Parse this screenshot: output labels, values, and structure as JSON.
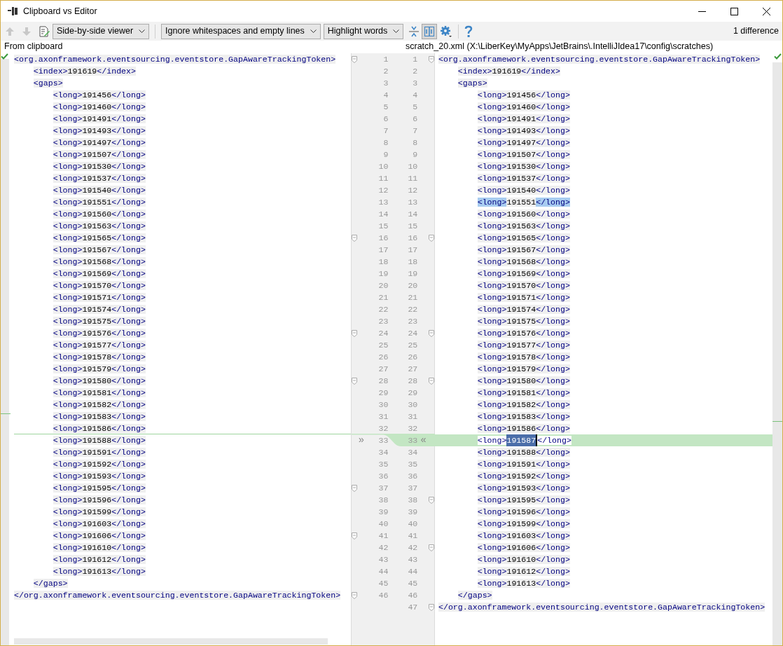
{
  "window": {
    "title": "Clipboard vs Editor"
  },
  "toolbar": {
    "viewer": "Side-by-side viewer",
    "whitespace": "Ignore whitespaces and empty lines",
    "highlighting": "Highlight words",
    "side_by_side_selected": true,
    "difference_count": "1 difference"
  },
  "gutter": {
    "apply_left": "»",
    "apply_right": "«"
  },
  "left_panel": {
    "header": "From clipboard",
    "lines": [
      {
        "number": "1",
        "text": "<org.axonframework.eventsourcing.eventstore.GapAwareTrackingToken>",
        "fold": true,
        "insertion_below": false
      },
      {
        "number": "2",
        "text": "    <index>191619</index>",
        "fold": false,
        "insertion_below": false
      },
      {
        "number": "3",
        "text": "    <gaps>",
        "fold": false,
        "insertion_below": false
      },
      {
        "number": "4",
        "text": "        <long>191456</long>",
        "fold": false,
        "insertion_below": false
      },
      {
        "number": "5",
        "text": "        <long>191460</long>",
        "fold": false,
        "insertion_below": false
      },
      {
        "number": "6",
        "text": "        <long>191491</long>",
        "fold": false,
        "insertion_below": false
      },
      {
        "number": "7",
        "text": "        <long>191493</long>",
        "fold": false,
        "insertion_below": false
      },
      {
        "number": "8",
        "text": "        <long>191497</long>",
        "fold": false,
        "insertion_below": false
      },
      {
        "number": "9",
        "text": "        <long>191507</long>",
        "fold": false,
        "insertion_below": false
      },
      {
        "number": "10",
        "text": "        <long>191530</long>",
        "fold": false,
        "insertion_below": false
      },
      {
        "number": "11",
        "text": "        <long>191537</long>",
        "fold": false,
        "insertion_below": false
      },
      {
        "number": "12",
        "text": "        <long>191540</long>",
        "fold": false,
        "insertion_below": false
      },
      {
        "number": "13",
        "text": "        <long>191551</long>",
        "fold": false,
        "insertion_below": false
      },
      {
        "number": "14",
        "text": "        <long>191560</long>",
        "fold": false,
        "insertion_below": false
      },
      {
        "number": "15",
        "text": "        <long>191563</long>",
        "fold": false,
        "insertion_below": false
      },
      {
        "number": "16",
        "text": "        <long>191565</long>",
        "fold": true,
        "insertion_below": false
      },
      {
        "number": "17",
        "text": "        <long>191567</long>",
        "fold": false,
        "insertion_below": false
      },
      {
        "number": "18",
        "text": "        <long>191568</long>",
        "fold": false,
        "insertion_below": false
      },
      {
        "number": "19",
        "text": "        <long>191569</long>",
        "fold": false,
        "insertion_below": false
      },
      {
        "number": "20",
        "text": "        <long>191570</long>",
        "fold": false,
        "insertion_below": false
      },
      {
        "number": "21",
        "text": "        <long>191571</long>",
        "fold": false,
        "insertion_below": false
      },
      {
        "number": "22",
        "text": "        <long>191574</long>",
        "fold": false,
        "insertion_below": false
      },
      {
        "number": "23",
        "text": "        <long>191575</long>",
        "fold": false,
        "insertion_below": false
      },
      {
        "number": "24",
        "text": "        <long>191576</long>",
        "fold": true,
        "insertion_below": false
      },
      {
        "number": "25",
        "text": "        <long>191577</long>",
        "fold": false,
        "insertion_below": false
      },
      {
        "number": "26",
        "text": "        <long>191578</long>",
        "fold": false,
        "insertion_below": false
      },
      {
        "number": "27",
        "text": "        <long>191579</long>",
        "fold": false,
        "insertion_below": false
      },
      {
        "number": "28",
        "text": "        <long>191580</long>",
        "fold": true,
        "insertion_below": false
      },
      {
        "number": "29",
        "text": "        <long>191581</long>",
        "fold": false,
        "insertion_below": false
      },
      {
        "number": "30",
        "text": "        <long>191582</long>",
        "fold": false,
        "insertion_below": false
      },
      {
        "number": "31",
        "text": "        <long>191583</long>",
        "fold": false,
        "insertion_below": false
      },
      {
        "number": "32",
        "text": "        <long>191586</long>",
        "fold": false,
        "insertion_below": true
      },
      {
        "number": "33",
        "text": "        <long>191588</long>",
        "fold": false,
        "insertion_below": false
      },
      {
        "number": "34",
        "text": "        <long>191591</long>",
        "fold": false,
        "insertion_below": false
      },
      {
        "number": "35",
        "text": "        <long>191592</long>",
        "fold": false,
        "insertion_below": false
      },
      {
        "number": "36",
        "text": "        <long>191593</long>",
        "fold": false,
        "insertion_below": false
      },
      {
        "number": "37",
        "text": "        <long>191595</long>",
        "fold": true,
        "insertion_below": false
      },
      {
        "number": "38",
        "text": "        <long>191596</long>",
        "fold": false,
        "insertion_below": false
      },
      {
        "number": "39",
        "text": "        <long>191599</long>",
        "fold": false,
        "insertion_below": false
      },
      {
        "number": "40",
        "text": "        <long>191603</long>",
        "fold": false,
        "insertion_below": false
      },
      {
        "number": "41",
        "text": "        <long>191606</long>",
        "fold": true,
        "insertion_below": false
      },
      {
        "number": "42",
        "text": "        <long>191610</long>",
        "fold": false,
        "insertion_below": false
      },
      {
        "number": "43",
        "text": "        <long>191612</long>",
        "fold": false,
        "insertion_below": false
      },
      {
        "number": "44",
        "text": "        <long>191613</long>",
        "fold": false,
        "insertion_below": false
      },
      {
        "number": "45",
        "text": "    </gaps>",
        "fold": false,
        "insertion_below": false
      },
      {
        "number": "46",
        "text": "</org.axonframework.eventsourcing.eventstore.GapAwareTrackingToken>",
        "fold": true,
        "insertion_below": false
      }
    ]
  },
  "right_panel": {
    "header": "scratch_20.xml (X:\\LiberKey\\MyApps\\JetBrains\\.IntelliJIdea17\\config\\scratches)",
    "lines": [
      {
        "number": "1",
        "text": "<org.axonframework.eventsourcing.eventstore.GapAwareTrackingToken>",
        "fold": true,
        "inserted": false,
        "tag_match": false
      },
      {
        "number": "2",
        "text": "    <index>191619</index>",
        "fold": false,
        "inserted": false,
        "tag_match": false
      },
      {
        "number": "3",
        "text": "    <gaps>",
        "fold": false,
        "inserted": false,
        "tag_match": false
      },
      {
        "number": "4",
        "text": "        <long>191456</long>",
        "fold": false,
        "inserted": false,
        "tag_match": false
      },
      {
        "number": "5",
        "text": "        <long>191460</long>",
        "fold": false,
        "inserted": false,
        "tag_match": false
      },
      {
        "number": "6",
        "text": "        <long>191491</long>",
        "fold": false,
        "inserted": false,
        "tag_match": false
      },
      {
        "number": "7",
        "text": "        <long>191493</long>",
        "fold": false,
        "inserted": false,
        "tag_match": false
      },
      {
        "number": "8",
        "text": "        <long>191497</long>",
        "fold": false,
        "inserted": false,
        "tag_match": false
      },
      {
        "number": "9",
        "text": "        <long>191507</long>",
        "fold": false,
        "inserted": false,
        "tag_match": false
      },
      {
        "number": "10",
        "text": "        <long>191530</long>",
        "fold": false,
        "inserted": false,
        "tag_match": false
      },
      {
        "number": "11",
        "text": "        <long>191537</long>",
        "fold": false,
        "inserted": false,
        "tag_match": false
      },
      {
        "number": "12",
        "text": "        <long>191540</long>",
        "fold": false,
        "inserted": false,
        "tag_match": false
      },
      {
        "number": "13",
        "text": "        <long>191551</long>",
        "fold": false,
        "inserted": false,
        "tag_match": true
      },
      {
        "number": "14",
        "text": "        <long>191560</long>",
        "fold": false,
        "inserted": false,
        "tag_match": false
      },
      {
        "number": "15",
        "text": "        <long>191563</long>",
        "fold": false,
        "inserted": false,
        "tag_match": false
      },
      {
        "number": "16",
        "text": "        <long>191565</long>",
        "fold": true,
        "inserted": false,
        "tag_match": false
      },
      {
        "number": "17",
        "text": "        <long>191567</long>",
        "fold": false,
        "inserted": false,
        "tag_match": false
      },
      {
        "number": "18",
        "text": "        <long>191568</long>",
        "fold": false,
        "inserted": false,
        "tag_match": false
      },
      {
        "number": "19",
        "text": "        <long>191569</long>",
        "fold": false,
        "inserted": false,
        "tag_match": false
      },
      {
        "number": "20",
        "text": "        <long>191570</long>",
        "fold": false,
        "inserted": false,
        "tag_match": false
      },
      {
        "number": "21",
        "text": "        <long>191571</long>",
        "fold": false,
        "inserted": false,
        "tag_match": false
      },
      {
        "number": "22",
        "text": "        <long>191574</long>",
        "fold": false,
        "inserted": false,
        "tag_match": false
      },
      {
        "number": "23",
        "text": "        <long>191575</long>",
        "fold": false,
        "inserted": false,
        "tag_match": false
      },
      {
        "number": "24",
        "text": "        <long>191576</long>",
        "fold": true,
        "inserted": false,
        "tag_match": false
      },
      {
        "number": "25",
        "text": "        <long>191577</long>",
        "fold": false,
        "inserted": false,
        "tag_match": false
      },
      {
        "number": "26",
        "text": "        <long>191578</long>",
        "fold": false,
        "inserted": false,
        "tag_match": false
      },
      {
        "number": "27",
        "text": "        <long>191579</long>",
        "fold": false,
        "inserted": false,
        "tag_match": false
      },
      {
        "number": "28",
        "text": "        <long>191580</long>",
        "fold": true,
        "inserted": false,
        "tag_match": false
      },
      {
        "number": "29",
        "text": "        <long>191581</long>",
        "fold": false,
        "inserted": false,
        "tag_match": false
      },
      {
        "number": "30",
        "text": "        <long>191582</long>",
        "fold": false,
        "inserted": false,
        "tag_match": false
      },
      {
        "number": "31",
        "text": "        <long>191583</long>",
        "fold": false,
        "inserted": false,
        "tag_match": false
      },
      {
        "number": "32",
        "text": "        <long>191586</long>",
        "fold": false,
        "inserted": false,
        "tag_match": false
      },
      {
        "number": "33",
        "segments": [
          {
            "text": "        <long>",
            "selected": false
          },
          {
            "text": "191587",
            "selected": true
          },
          {
            "text": "</long>",
            "selected": false
          }
        ],
        "fold": false,
        "inserted": true,
        "tag_match": false
      },
      {
        "number": "34",
        "text": "        <long>191588</long>",
        "fold": false,
        "inserted": false,
        "tag_match": false
      },
      {
        "number": "35",
        "text": "        <long>191591</long>",
        "fold": false,
        "inserted": false,
        "tag_match": false
      },
      {
        "number": "36",
        "text": "        <long>191592</long>",
        "fold": false,
        "inserted": false,
        "tag_match": false
      },
      {
        "number": "37",
        "text": "        <long>191593</long>",
        "fold": false,
        "inserted": false,
        "tag_match": false
      },
      {
        "number": "38",
        "text": "        <long>191595</long>",
        "fold": true,
        "inserted": false,
        "tag_match": false
      },
      {
        "number": "39",
        "text": "        <long>191596</long>",
        "fold": false,
        "inserted": false,
        "tag_match": false
      },
      {
        "number": "40",
        "text": "        <long>191599</long>",
        "fold": false,
        "inserted": false,
        "tag_match": false
      },
      {
        "number": "41",
        "text": "        <long>191603</long>",
        "fold": false,
        "inserted": false,
        "tag_match": false
      },
      {
        "number": "42",
        "text": "        <long>191606</long>",
        "fold": true,
        "inserted": false,
        "tag_match": false
      },
      {
        "number": "43",
        "text": "        <long>191610</long>",
        "fold": false,
        "inserted": false,
        "tag_match": false
      },
      {
        "number": "44",
        "text": "        <long>191612</long>",
        "fold": false,
        "inserted": false,
        "tag_match": false
      },
      {
        "number": "45",
        "text": "        <long>191613</long>",
        "fold": false,
        "inserted": false,
        "tag_match": false
      },
      {
        "number": "46",
        "text": "    </gaps>",
        "fold": false,
        "inserted": false,
        "tag_match": false
      },
      {
        "number": "47",
        "text": "</org.axonframework.eventsourcing.eventstore.GapAwareTrackingToken>",
        "fold": true,
        "inserted": false,
        "tag_match": false
      }
    ]
  }
}
